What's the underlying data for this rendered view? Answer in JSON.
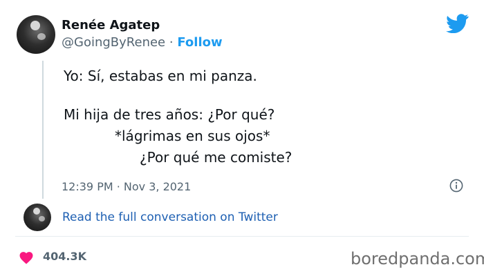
{
  "author": {
    "display_name": "Renée Agatep",
    "handle": "@GoingByRenee",
    "separator": "·",
    "follow_label": "Follow"
  },
  "tweet": {
    "lines": [
      "Yo: Sí, estabas en mi panza.",
      "Mi hija de tres años: ¿Por qué?",
      "*lágrimas en sus ojos*",
      "¿Por qué me comiste?"
    ],
    "timestamp": "12:39 PM · Nov 3, 2021"
  },
  "conversation_link": "Read the full conversation on Twitter",
  "likes": "404.3K",
  "source": "boredpanda.com",
  "icons": {
    "brand": "twitter-bird-icon",
    "info": "info-icon",
    "like": "heart-icon"
  },
  "colors": {
    "twitter_blue": "#1d9bf0",
    "link_blue": "#1d5fb2",
    "heart_pink": "#f91880",
    "muted_text": "#536471"
  }
}
